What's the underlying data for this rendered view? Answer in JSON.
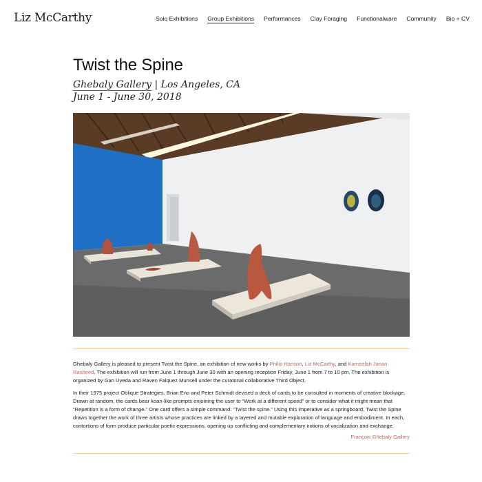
{
  "site": {
    "title": "Liz McCarthy"
  },
  "nav": {
    "items": [
      {
        "label": "Solo Exhibitions"
      },
      {
        "label": "Group Exhibitions",
        "active": true
      },
      {
        "label": "Performances"
      },
      {
        "label": "Clay Foraging"
      },
      {
        "label": "Functionalware"
      },
      {
        "label": "Community"
      },
      {
        "label": "Bio + CV"
      }
    ]
  },
  "exhibition": {
    "title": "Twist the Spine",
    "venue": "Ghebaly Gallery",
    "separator": " | ",
    "location": "Los Angeles, CA",
    "dates": "June 1 - June 30, 2018"
  },
  "body": {
    "p1_before": "Ghebaly Gallery is pleased to present Twist the Spine, an exhibition of new works by ",
    "artists": [
      "Philip Hanson",
      "Liz McCarthy",
      "Kameelah Janan Rasheed"
    ],
    "sep_comma": ", ",
    "sep_and": ", and ",
    "p1_after": ". The exhibition will run from June 1 through June 30 with an opening reception Friday, June 1 from 7 to 10 pm. The exhibition is organized by Gan Uyeda and Raven Falquez Munsell under the curatorial collaborative Third Object.",
    "p2": "In their 1975 project Oblique Strategies, Brian Eno and Peter Schmidt devised a deck of cards to be consulted in moments of creative blockage. Drawn at random, the cards bear koan-like prompts enjoining the user to “Work at a different speed” or to consider what it might mean that “Repetition is a form of change.” One card offers a simple command: “Twist the spine.” Using this imperative as a springboard, Twist the Spine draws together the work of three artists whose practices are linked by a layered and mutable exploration of language and embodiment. In each, contortions of form produce particular poetic expressions, opening up conflicting and complementary notions of vocalization and exchange.",
    "source_link": "François Ghebaly Gallery"
  },
  "colors": {
    "link": "#c26a63",
    "divider": "#f2d3a8",
    "venue_underline": "#c0392b",
    "blue_wall": "#1f6fc4"
  },
  "image": {
    "description_icon": "gallery-installation-photo"
  }
}
